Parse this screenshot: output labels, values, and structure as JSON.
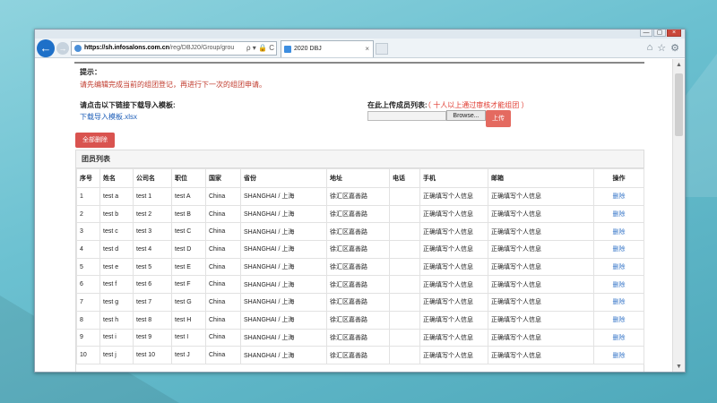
{
  "browser": {
    "address_host": "https://sh.infosalons.com.cn",
    "address_path": "/reg/DBJ20/Group/grou",
    "address_tools": "ρ ▾ 🔒 C",
    "tab_title": "2020 DBJ",
    "tab_close": "×",
    "back": "←",
    "forward": "→",
    "window_min": "—",
    "window_max": "▢",
    "window_close": "×",
    "home_icon": "⌂",
    "fav_icon": "☆",
    "settings_icon": "⚙"
  },
  "page": {
    "hint_label": "提示：",
    "hint_text": "请先编辑完成当前的组团登记，再进行下一次的组团申请。",
    "download_label": "请点击以下链接下载导入模板:",
    "download_link": "下载导入模板.xlsx",
    "upload_label": "在此上传成员列表:",
    "upload_note": "（ 十人以上通过审核才能组团 ）",
    "browse_label": "Browse...",
    "upload_button": "上传",
    "delete_all_button": "全部删除",
    "panel_title": "团员列表"
  },
  "table": {
    "headers": [
      "序号",
      "姓名",
      "公司名",
      "职位",
      "国家",
      "省份",
      "地址",
      "电话",
      "手机",
      "邮箱",
      "操作"
    ],
    "rows": [
      [
        "1",
        "test a",
        "test 1",
        "test A",
        "China",
        "SHANGHAI / 上海",
        "徐汇区嘉善路",
        "",
        "正确填写个人信息",
        "正确填写个人信息",
        "删除"
      ],
      [
        "2",
        "test b",
        "test 2",
        "test B",
        "China",
        "SHANGHAI / 上海",
        "徐汇区嘉善路",
        "",
        "正确填写个人信息",
        "正确填写个人信息",
        "删除"
      ],
      [
        "3",
        "test c",
        "test 3",
        "test C",
        "China",
        "SHANGHAI / 上海",
        "徐汇区嘉善路",
        "",
        "正确填写个人信息",
        "正确填写个人信息",
        "删除"
      ],
      [
        "4",
        "test d",
        "test 4",
        "test D",
        "China",
        "SHANGHAI / 上海",
        "徐汇区嘉善路",
        "",
        "正确填写个人信息",
        "正确填写个人信息",
        "删除"
      ],
      [
        "5",
        "test e",
        "test 5",
        "test E",
        "China",
        "SHANGHAI / 上海",
        "徐汇区嘉善路",
        "",
        "正确填写个人信息",
        "正确填写个人信息",
        "删除"
      ],
      [
        "6",
        "test f",
        "test 6",
        "test F",
        "China",
        "SHANGHAI / 上海",
        "徐汇区嘉善路",
        "",
        "正确填写个人信息",
        "正确填写个人信息",
        "删除"
      ],
      [
        "7",
        "test g",
        "test 7",
        "test G",
        "China",
        "SHANGHAI / 上海",
        "徐汇区嘉善路",
        "",
        "正确填写个人信息",
        "正确填写个人信息",
        "删除"
      ],
      [
        "8",
        "test h",
        "test 8",
        "test H",
        "China",
        "SHANGHAI / 上海",
        "徐汇区嘉善路",
        "",
        "正确填写个人信息",
        "正确填写个人信息",
        "删除"
      ],
      [
        "9",
        "test i",
        "test 9",
        "test I",
        "China",
        "SHANGHAI / 上海",
        "徐汇区嘉善路",
        "",
        "正确填写个人信息",
        "正确填写个人信息",
        "删除"
      ],
      [
        "10",
        "test j",
        "test 10",
        "test J",
        "China",
        "SHANGHAI / 上海",
        "徐汇区嘉善路",
        "",
        "正确填写个人信息",
        "正确填写个人信息",
        "删除"
      ]
    ]
  },
  "colors": {
    "hint_red": "#c0392b",
    "link_blue": "#1f5fb8",
    "button_red": "#d9534f",
    "upload_red": "#e46a60"
  }
}
